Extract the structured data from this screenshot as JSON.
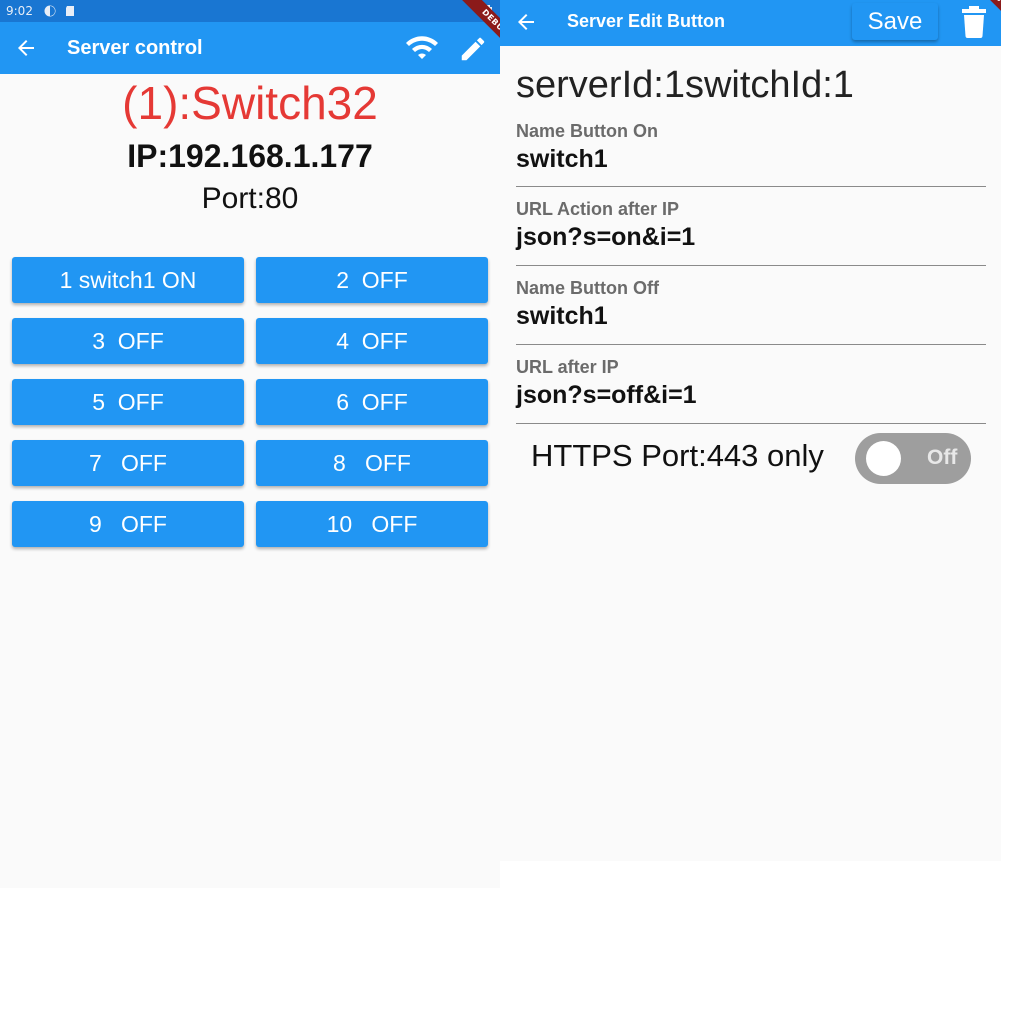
{
  "left_screen": {
    "statusbar": {
      "time": "9:02"
    },
    "appbar": {
      "title": "Server control",
      "debug_banner": "DEBUG"
    },
    "server": {
      "name": "(1):Switch32",
      "ip": "IP:192.168.1.177",
      "port": "Port:80"
    },
    "switch_buttons": [
      {
        "label": "1 switch1 ON"
      },
      {
        "label": "2  OFF"
      },
      {
        "label": "3  OFF"
      },
      {
        "label": "4  OFF"
      },
      {
        "label": "5  OFF"
      },
      {
        "label": "6  OFF"
      },
      {
        "label": "7   OFF"
      },
      {
        "label": "8   OFF"
      },
      {
        "label": "9   OFF"
      },
      {
        "label": "10   OFF"
      }
    ],
    "colors": {
      "appbar": "#2196f3",
      "statusbar": "#1976d2",
      "server_name": "#e53935"
    }
  },
  "right_screen": {
    "appbar": {
      "title": "Server Edit Button",
      "save_label": "Save",
      "debug_banner": "DEBUG"
    },
    "heading": "serverId:1switchId:1",
    "fields": [
      {
        "label": "Name Button On",
        "value": "switch1"
      },
      {
        "label": "URL Action after IP",
        "value": "json?s=on&i=1"
      },
      {
        "label": "Name Button Off",
        "value": "switch1"
      },
      {
        "label": "URL after IP",
        "value": "json?s=off&i=1"
      }
    ],
    "https": {
      "label": "HTTPS Port:443 only",
      "toggle_label": "Off",
      "toggle_on": false
    }
  }
}
